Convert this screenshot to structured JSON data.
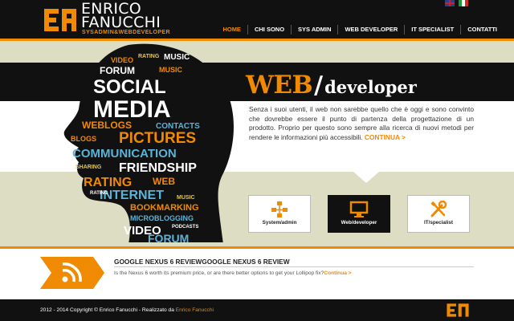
{
  "brand": {
    "name_line1": "ENRICO",
    "name_line2": "FANUCCHI",
    "tagline": "SYSADMIN&WEBDEVELOPER"
  },
  "languages": [
    {
      "icon": "uk-flag-icon"
    },
    {
      "icon": "italy-flag-icon"
    }
  ],
  "nav": {
    "items": [
      {
        "label": "HOME",
        "active": true
      },
      {
        "label": "CHI SONO"
      },
      {
        "label": "SYS ADMIN"
      },
      {
        "label": "WEB DEVELOPER"
      },
      {
        "label": "IT SPECIALIST"
      },
      {
        "label": "CONTATTI"
      }
    ]
  },
  "hero": {
    "title_primary": "WEB",
    "title_slash": "/",
    "title_secondary": "developer",
    "body": "Senza i suoi utenti, il web non sarebbe quello che è oggi e sono convinto che dovrebbe essere il punto di partenza della progettazione di un prodotto. Proprio per questo sono sempre alla ricerca di nuovi metodi per rendere le informazioni più accessibili.",
    "continue_label": "CONTINUA >",
    "head_words": [
      "VIDEO",
      "MUSIC",
      "FORUM",
      "SOCIAL",
      "MEDIA",
      "WEBLOGS",
      "BLOGS",
      "CONTACTS",
      "PICTURES",
      "COMMUNICATION",
      "FRIENDSHIP",
      "WEB",
      "RATING",
      "INTERNET",
      "BOOKMARKING",
      "MICROBLOGGING",
      "VIDEO",
      "FORUM",
      "PODCASTS",
      "SHARING",
      "MUSIC",
      "RATING",
      "RSS",
      "FRIENDS"
    ]
  },
  "services": [
    {
      "label": "System/admin",
      "icon": "network-icon",
      "active": false
    },
    {
      "label": "Web/developer",
      "icon": "monitor-icon",
      "active": true
    },
    {
      "label": "IT/specialist",
      "icon": "tools-icon",
      "active": false
    }
  ],
  "news": {
    "icon": "rss-icon",
    "title": "GOOGLE NEXUS 6 REVIEWGOOGLE NEXUS 6 REVIEW",
    "text": "Is the Nexus 6 worth its premium price, or are there better options to get your Lollipop fix?",
    "continue_label": "Continua >"
  },
  "footer": {
    "copyright": "2012 - 2014 Copyright © Enrico Fanucchi - Realizzato da ",
    "author_link": "Enrico Fanucchi"
  },
  "colors": {
    "accent": "#f08a00",
    "dark": "#111111",
    "beige": "#ddddc4"
  }
}
